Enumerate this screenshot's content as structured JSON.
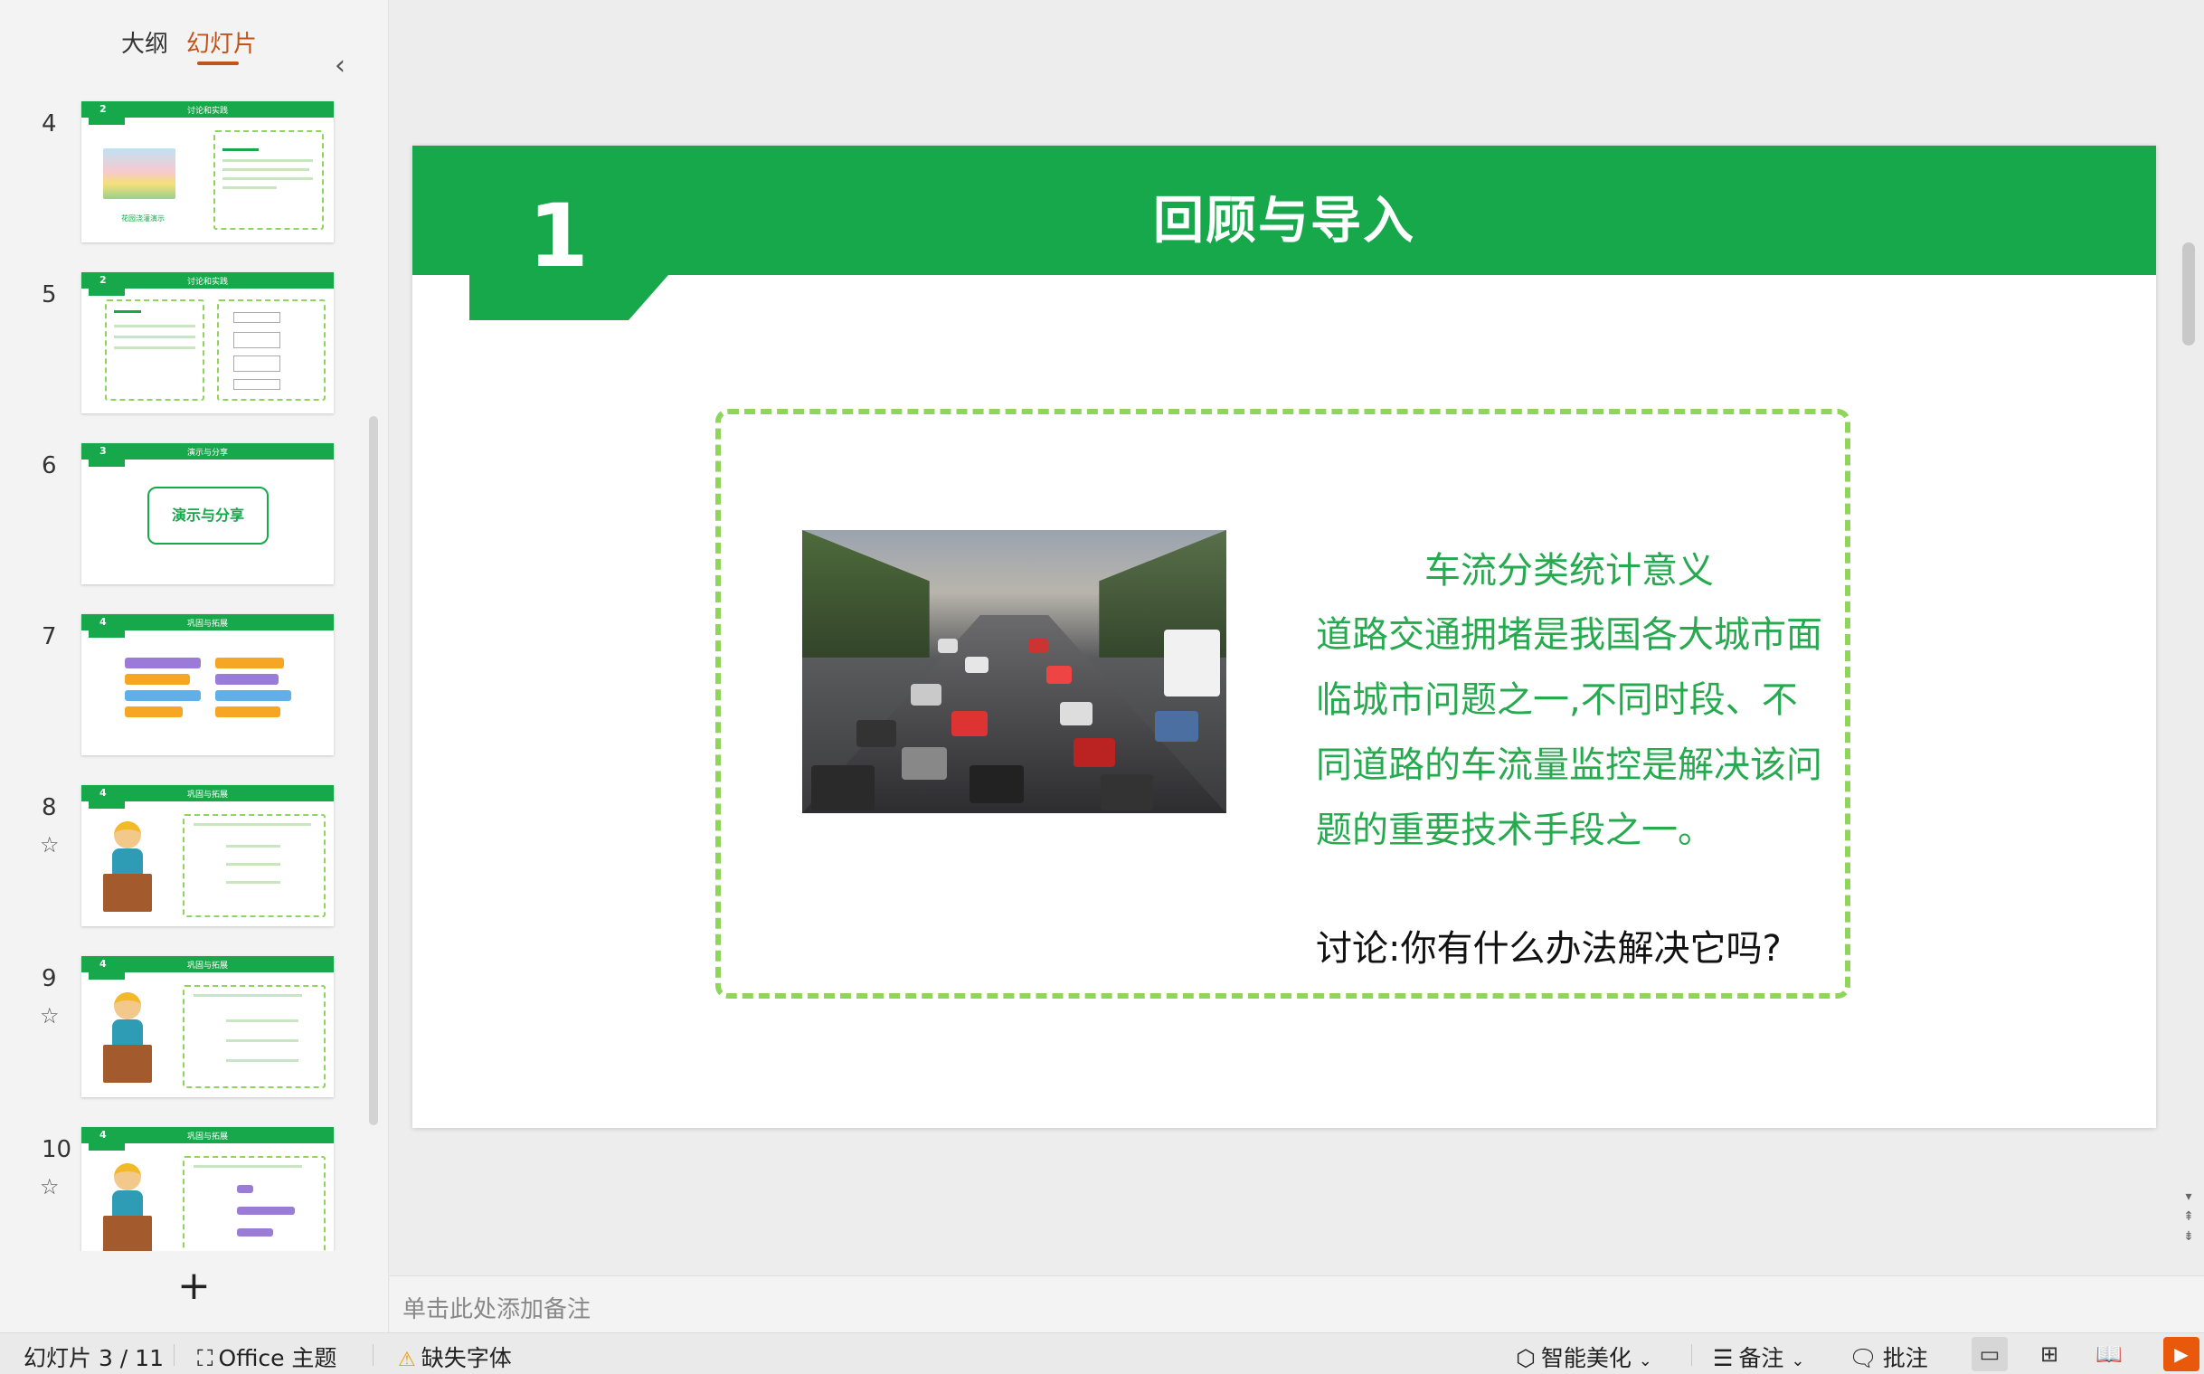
{
  "panel": {
    "tab_outline": "大纲",
    "tab_slides": "幻灯片",
    "collapse_icon": "chevron-left-icon",
    "add_icon": "plus-icon"
  },
  "thumbnails": [
    {
      "number": "4",
      "badge": "2",
      "title": "讨论和实践",
      "caption": "花园浇灌演示"
    },
    {
      "number": "5",
      "badge": "2",
      "title": "讨论和实践"
    },
    {
      "number": "6",
      "badge": "3",
      "title": "演示与分享",
      "center_text": "演示与分享"
    },
    {
      "number": "7",
      "badge": "4",
      "title": "巩固与拓展"
    },
    {
      "number": "8",
      "badge": "4",
      "title": "巩固与拓展"
    },
    {
      "number": "9",
      "badge": "4",
      "title": "巩固与拓展"
    },
    {
      "number": "10",
      "badge": "4",
      "title": "巩固与拓展"
    }
  ],
  "slide": {
    "section_number": "1",
    "title": "回顾与导入",
    "heading": "车流分类统计意义",
    "paragraph": "道路交通拥堵是我国各大城市面临城市问题之一,不同时段、不同道路的车流量监控是解决该问题的重要技术手段之一。",
    "question": "讨论:你有什么办法解决它吗?",
    "accent_color": "#17a84b",
    "dash_color": "#8fd45b",
    "text_color": "#26a94f"
  },
  "notes": {
    "placeholder": "单击此处添加备注"
  },
  "status": {
    "slide_counter": "幻灯片 3 / 11",
    "theme": "Office 主题",
    "missing_font": "缺失字体",
    "smart_beautify": "智能美化",
    "notes": "备注",
    "comments": "批注"
  }
}
